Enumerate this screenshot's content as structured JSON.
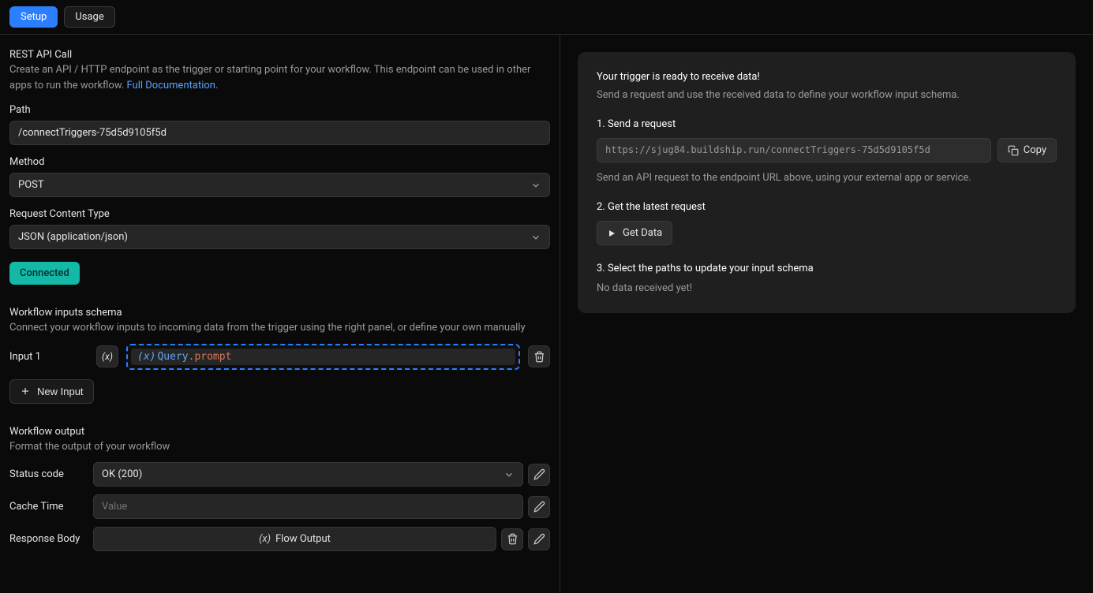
{
  "tabs": {
    "setup": "Setup",
    "usage": "Usage"
  },
  "header": {
    "title": "REST API Call",
    "desc_prefix": "Create an API / HTTP endpoint as the trigger or starting point for your workflow. This endpoint can be used in other apps to run the workflow. ",
    "doc_link": "Full Documentation",
    "doc_suffix": "."
  },
  "fields": {
    "path_label": "Path",
    "path_value": "/connectTriggers-75d5d9105f5d",
    "method_label": "Method",
    "method_value": "POST",
    "content_type_label": "Request Content Type",
    "content_type_value": "JSON (application/json)"
  },
  "connected_badge": "Connected",
  "inputs_schema": {
    "title": "Workflow inputs schema",
    "desc": "Connect your workflow inputs to incoming data from the trigger using the right panel, or define your own manually",
    "input1_label": "Input 1",
    "input1_var": "Query",
    "input1_suffix": ".prompt",
    "new_input": "New Input"
  },
  "output": {
    "title": "Workflow output",
    "desc": "Format the output of your workflow",
    "status_label": "Status code",
    "status_value": "OK (200)",
    "cache_label": "Cache Time",
    "cache_placeholder": "Value",
    "body_label": "Response Body",
    "body_value": "Flow Output"
  },
  "right": {
    "ready_title": "Your trigger is ready to receive data!",
    "ready_desc": "Send a request and use the received data to define your workflow input schema.",
    "step1": "1. Send a request",
    "url": "https://sjug84.buildship.run/connectTriggers-75d5d9105f5d",
    "copy": "Copy",
    "step1_hint": "Send an API request to the endpoint URL above, using your external app or service.",
    "step2": "2. Get the latest request",
    "get_data": "Get Data",
    "step3": "3. Select the paths to update your input schema",
    "no_data": "No data received yet!"
  }
}
